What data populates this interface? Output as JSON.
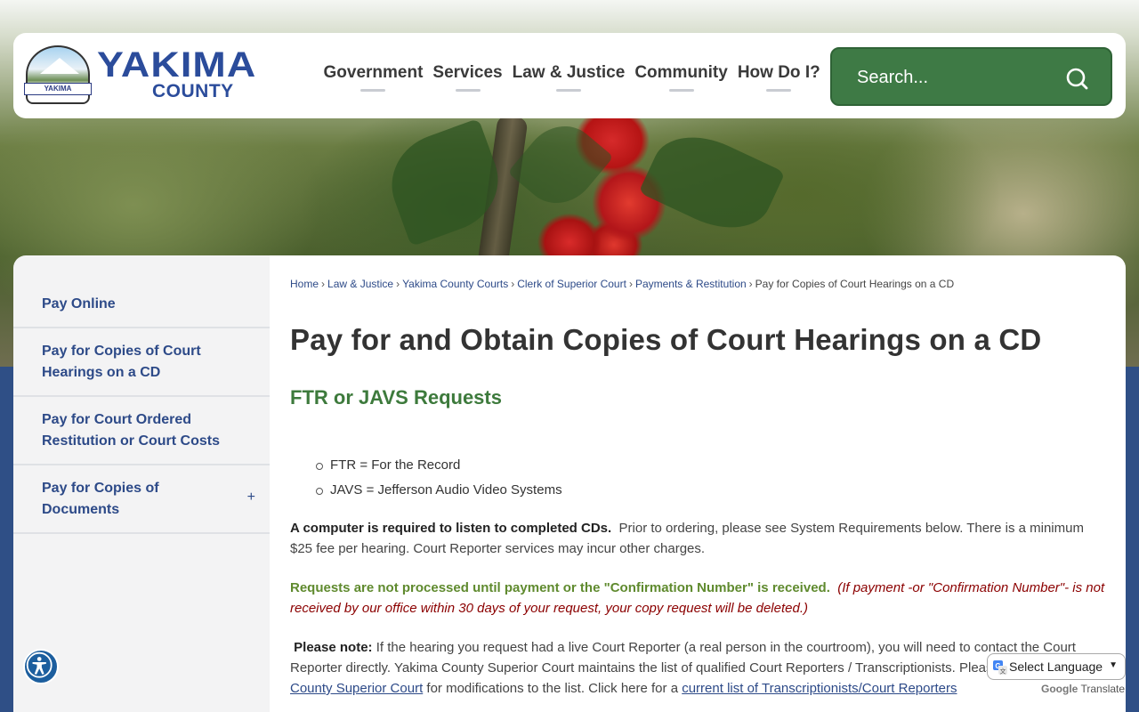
{
  "header": {
    "logo_line1": "YAKIMA",
    "logo_line2": "COUNTY",
    "logo_band": "YAKIMA",
    "nav": [
      "Government",
      "Services",
      "Law & Justice",
      "Community",
      "How Do I?"
    ],
    "search_placeholder": "Search..."
  },
  "sidebar": {
    "items": [
      {
        "label": "Pay Online"
      },
      {
        "label": "Pay for Copies of Court Hearings on a CD"
      },
      {
        "label": "Pay for Court Ordered Restitution or Court Costs"
      },
      {
        "label": "Pay for Copies of Documents",
        "expand": "+"
      }
    ]
  },
  "breadcrumb": [
    "Home",
    "Law & Justice",
    "Yakima County Courts",
    "Clerk of Superior Court",
    "Payments & Restitution",
    "Pay for Copies of Court Hearings on a CD"
  ],
  "page": {
    "title": "Pay for and Obtain Copies of Court Hearings on a CD",
    "subhead": "FTR or JAVS Requests",
    "definitions": [
      "FTR = For the Record",
      "JAVS = Jefferson Audio Video Systems"
    ],
    "p1_bold": "A computer is required to listen to completed CDs.",
    "p1_rest": "Prior to ordering, please see System Requirements below.  There is a minimum $25 fee per hearing. Court Reporter services may incur other charges.",
    "p2_green": "Requests are not processed until payment or the \"Confirmation Number\"  is received.",
    "p2_red": "(If payment -or \"Confirmation Number\"- is not received by our office within 30 days of your request, your copy request will be deleted.)",
    "p3_bold": "Please note:",
    "p3_text": "If the hearing you request had a live Court Reporter (a real person in the courtroom), you will need to contact the Court Reporter directly. Yakima County Superior Court maintains the list of qualified Court Reporters / Transcriptionists. Please contact",
    "p3_link1": "Yakima County Superior Court",
    "p3_mid": "for modifications to the list.  Click here for a",
    "p3_link2": "current list of Transcriptionists/Court Reporters"
  },
  "translate": {
    "select_label": "Select Language",
    "powered_g": "Google",
    "powered_t": "Translate"
  },
  "colors": {
    "brand_blue": "#2b4c9b",
    "search_green": "#3e7a45",
    "subhead_green": "#3d7a3c",
    "link": "#2d4a88",
    "warning_red": "#8b0000"
  },
  "icons": {
    "search": "search-icon",
    "accessibility": "accessibility-icon",
    "google_translate": "google-translate-icon"
  }
}
